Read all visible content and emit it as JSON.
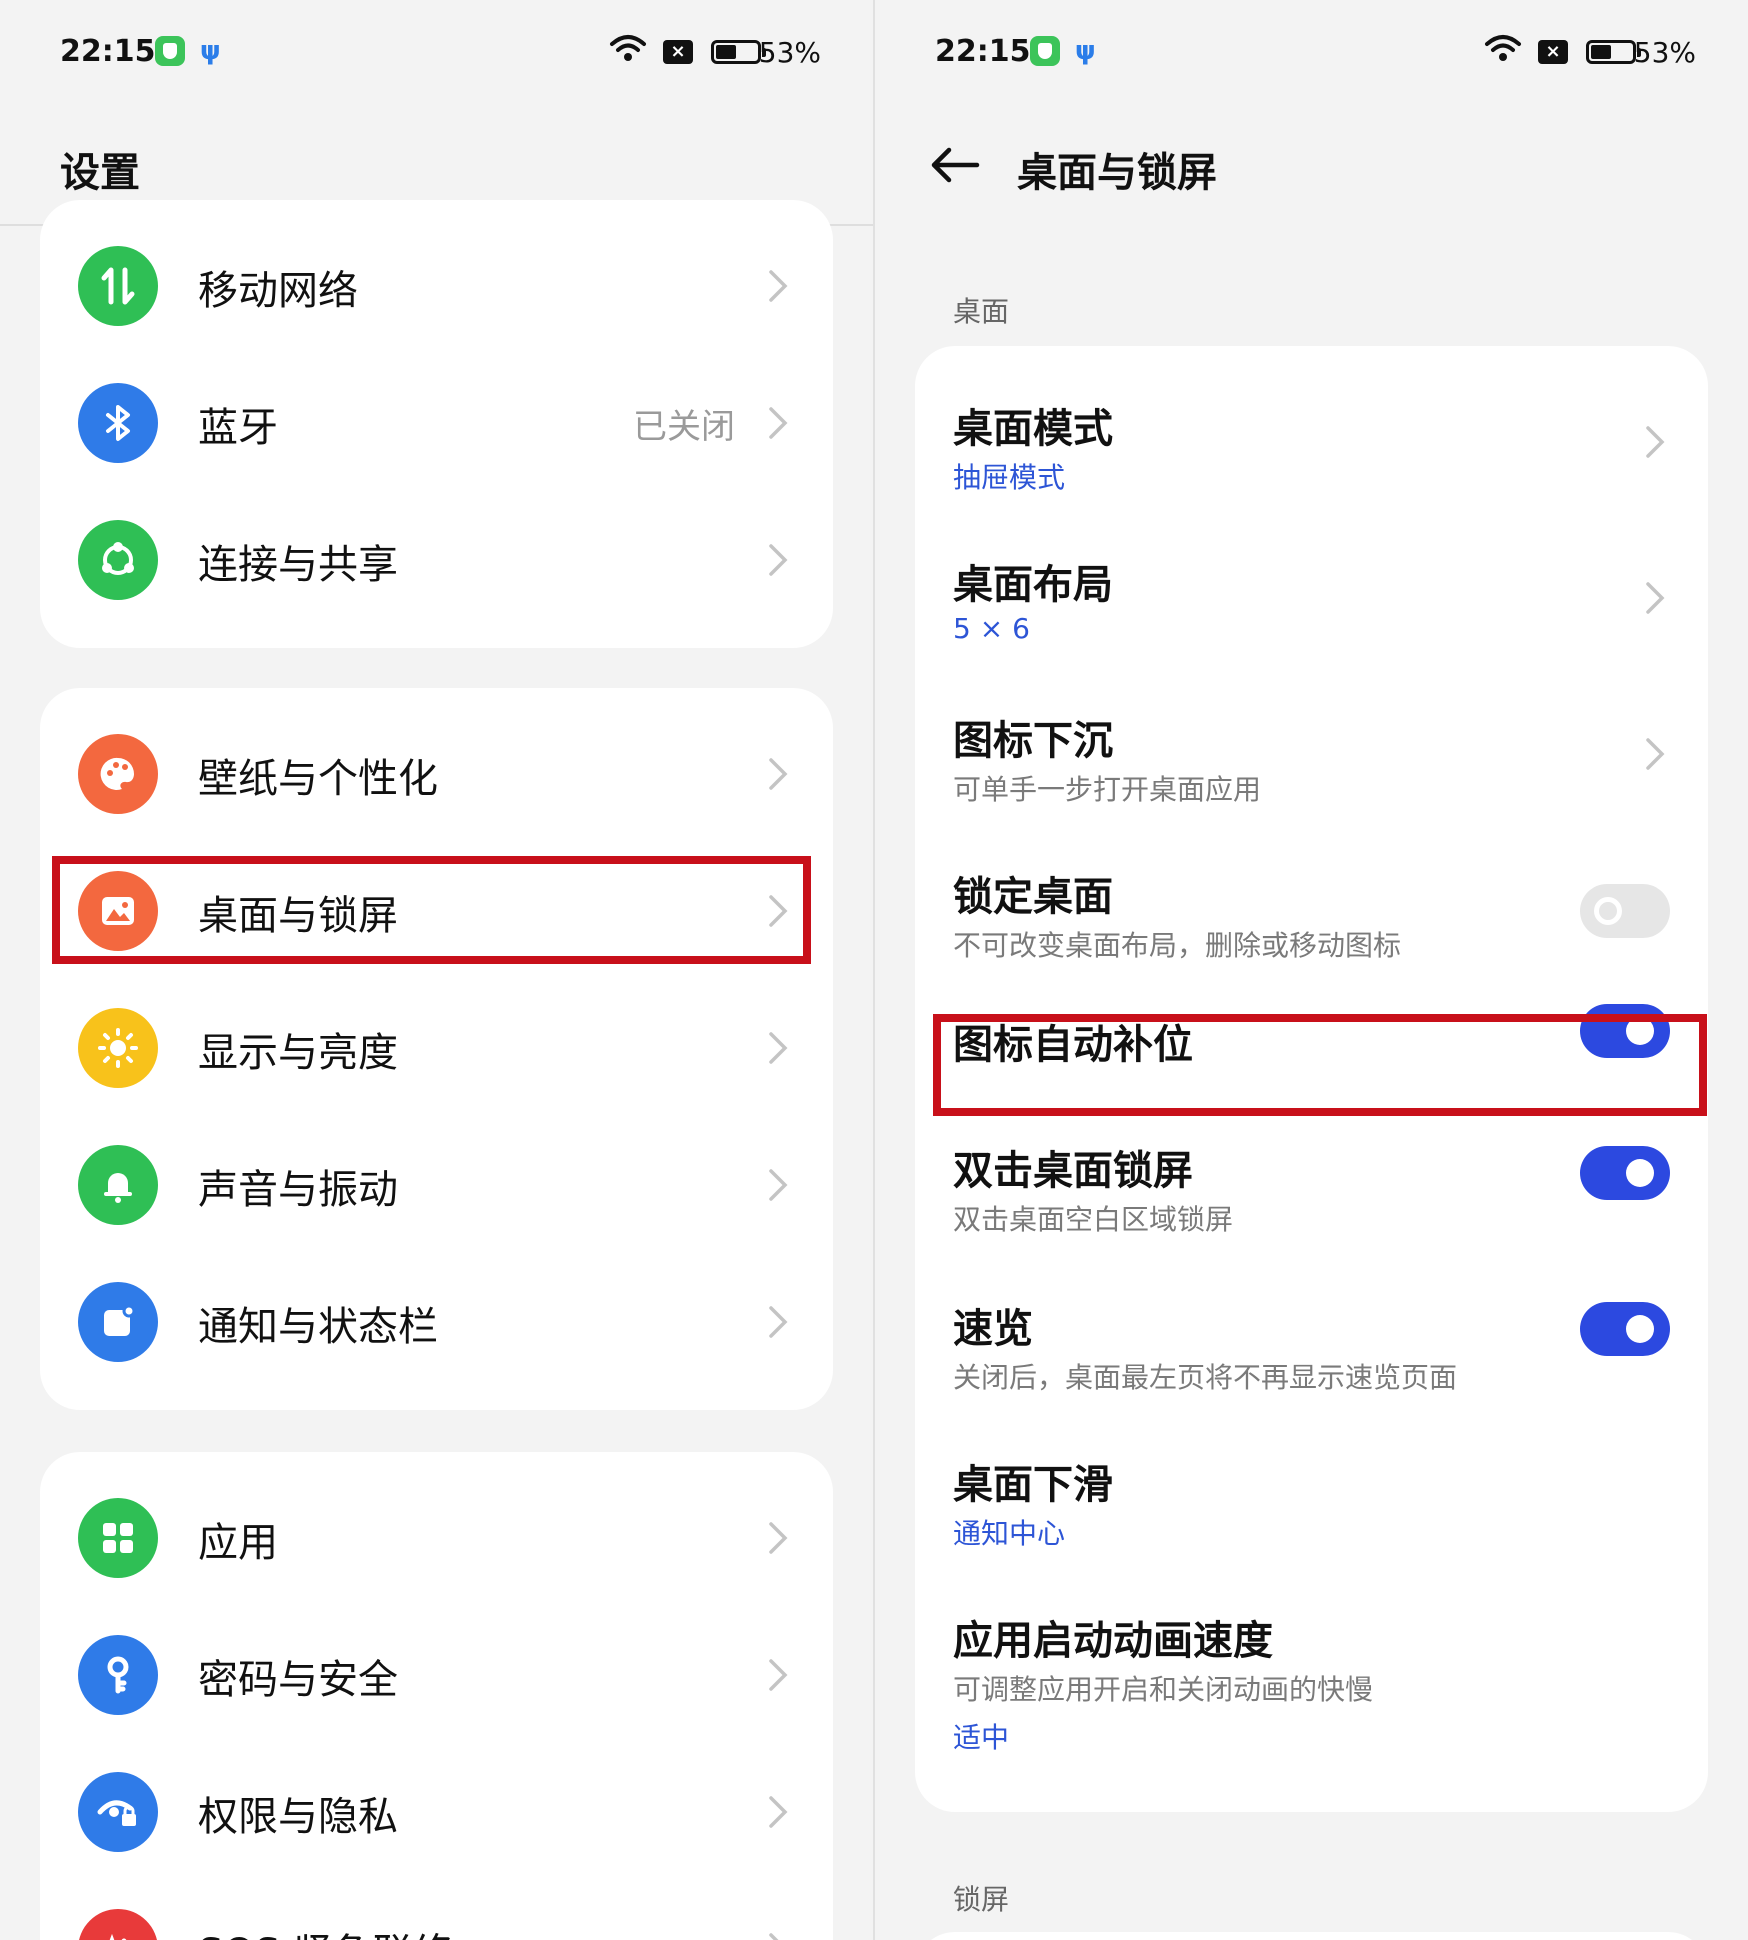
{
  "status_bar": {
    "time": "22:15",
    "battery": "53%",
    "app_icon_2": "ψ"
  },
  "settings": {
    "title": "设置",
    "group1": [
      {
        "label": "移动网络",
        "icon": "mobile-data-icon",
        "color": "#2fbf55",
        "value": ""
      },
      {
        "label": "蓝牙",
        "icon": "bluetooth-icon",
        "color": "#2f7be8",
        "value": "已关闭"
      },
      {
        "label": "连接与共享",
        "icon": "share-icon",
        "color": "#2fbf55",
        "value": ""
      }
    ],
    "group2": [
      {
        "label": "壁纸与个性化",
        "icon": "palette-icon",
        "color": "#f3683f"
      },
      {
        "label": "桌面与锁屏",
        "icon": "picture-icon",
        "color": "#f3683f"
      },
      {
        "label": "显示与亮度",
        "icon": "sun-icon",
        "color": "#f8c21b"
      },
      {
        "label": "声音与振动",
        "icon": "bell-icon",
        "color": "#2fbf55"
      },
      {
        "label": "通知与状态栏",
        "icon": "notification-icon",
        "color": "#2f7be8"
      }
    ],
    "group3": [
      {
        "label": "应用",
        "icon": "apps-icon",
        "color": "#2fbf55"
      },
      {
        "label": "密码与安全",
        "icon": "key-icon",
        "color": "#2f7be8"
      },
      {
        "label": "权限与隐私",
        "icon": "privacy-eye-icon",
        "color": "#2f7be8"
      },
      {
        "label": "SOS 紧急联络",
        "icon": "sos-icon",
        "color": "#e83a3a"
      }
    ]
  },
  "desktop": {
    "title": "桌面与锁屏",
    "section_desktop": "桌面",
    "section_lock": "锁屏",
    "items": [
      {
        "title": "桌面模式",
        "value": "抽屉模式"
      },
      {
        "title": "桌面布局",
        "value": "5 × 6"
      },
      {
        "title": "图标下沉",
        "sub": "可单手一步打开桌面应用"
      },
      {
        "title": "锁定桌面",
        "sub": "不可改变桌面布局，删除或移动图标",
        "toggle": false
      },
      {
        "title": "图标自动补位",
        "toggle": true
      },
      {
        "title": "双击桌面锁屏",
        "sub": "双击桌面空白区域锁屏",
        "toggle": true
      },
      {
        "title": "速览",
        "sub": "关闭后，桌面最左页将不再显示速览页面",
        "toggle": true
      },
      {
        "title": "桌面下滑",
        "value": "通知中心"
      },
      {
        "title": "应用启动动画速度",
        "sub": "可调整应用开启和关闭动画的快慢",
        "value": "适中"
      }
    ]
  }
}
